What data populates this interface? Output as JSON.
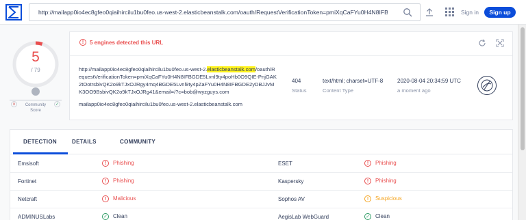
{
  "colors": {
    "accent": "#0b4dda",
    "malicious": "#e94f4f",
    "suspicious": "#f5a623",
    "clean": "#2c9b63"
  },
  "search": {
    "url": "http://mailapp0io4ec8gfeo0qiaihircilu1bu0feo.us-west-2.elasticbeanstalk.com/oauth/RequestVerificationToken=pmiXqCaFYu0H4N8IFBGDE5Lv"
  },
  "header": {
    "signin_label": "Sign in",
    "signup_label": "Sign up"
  },
  "score": {
    "detections": "5",
    "total": "/ 79",
    "community_label_1": "Community",
    "community_label_2": "Score",
    "community_x": "x",
    "community_check": "✓"
  },
  "summary": {
    "alert": "5 engines detected this URL",
    "url_before_highlight": "http://mailapp0io4ec8gfeo0qiaihircilu1bu0feo.us-west-2.",
    "url_highlight": "elasticbeanstalk.com",
    "url_after_highlight": "/oauth/RequestVerificationToken=pmiXqCaFYu0H4N8IFBGDE5Lvnl9ty4poHb0O9QIE-PnjGAK2tOotrsbivQK2o9kTJxOJRgy4mq4BGDE5Lvnl9ty4pZaFYu0H4N8IFBGDE2yDBJJvMK3OO9BsbivQK2o9kTJxOJRg41&email=/?c=bob@wyzguys.com",
    "host": "mailapp0io4ec8gfeo0qiaihircilu1bu0feo.us-west-2.elasticbeanstalk.com",
    "status_value": "404",
    "status_label": "Status",
    "content_type_value": "text/html; charset=UTF-8",
    "content_type_label": "Content Type",
    "date_value": "2020-08-04 20:34:59 UTC",
    "date_label": "a moment ago"
  },
  "tabs": [
    "DETECTION",
    "DETAILS",
    "COMMUNITY"
  ],
  "detections": [
    {
      "left_engine": "Emsisoft",
      "left_result": "Phishing",
      "left_kind": "malicious",
      "right_engine": "ESET",
      "right_result": "Phishing",
      "right_kind": "malicious"
    },
    {
      "left_engine": "Fortinet",
      "left_result": "Phishing",
      "left_kind": "malicious",
      "right_engine": "Kaspersky",
      "right_result": "Phishing",
      "right_kind": "malicious"
    },
    {
      "left_engine": "Netcraft",
      "left_result": "Malicious",
      "left_kind": "malicious",
      "right_engine": "Sophos AV",
      "right_result": "Suspicious",
      "right_kind": "suspicious"
    },
    {
      "left_engine": "ADMINUSLabs",
      "left_result": "Clean",
      "left_kind": "clean",
      "right_engine": "AegisLab WebGuard",
      "right_result": "Clean",
      "right_kind": "clean"
    }
  ]
}
